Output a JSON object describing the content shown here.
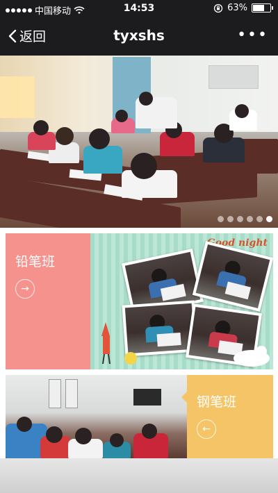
{
  "status_bar": {
    "carrier": "中国移动",
    "time": "14:53",
    "battery": "63%",
    "battery_level": 0.63
  },
  "nav": {
    "back_label": "返回",
    "title": "tyxshs",
    "more_label": "•••"
  },
  "banner": {
    "slide_count": 6,
    "active_index": 5
  },
  "courses": [
    {
      "label": "铅笔班",
      "arrow": "→",
      "photo_text": "Good night"
    },
    {
      "label": "钢笔班",
      "arrow": "←"
    }
  ],
  "colors": {
    "header_bg": "#1c1c1e",
    "pencil_card": "#f5928e",
    "pen_card": "#f4c466",
    "stripe_green": "#a7dcc9"
  }
}
